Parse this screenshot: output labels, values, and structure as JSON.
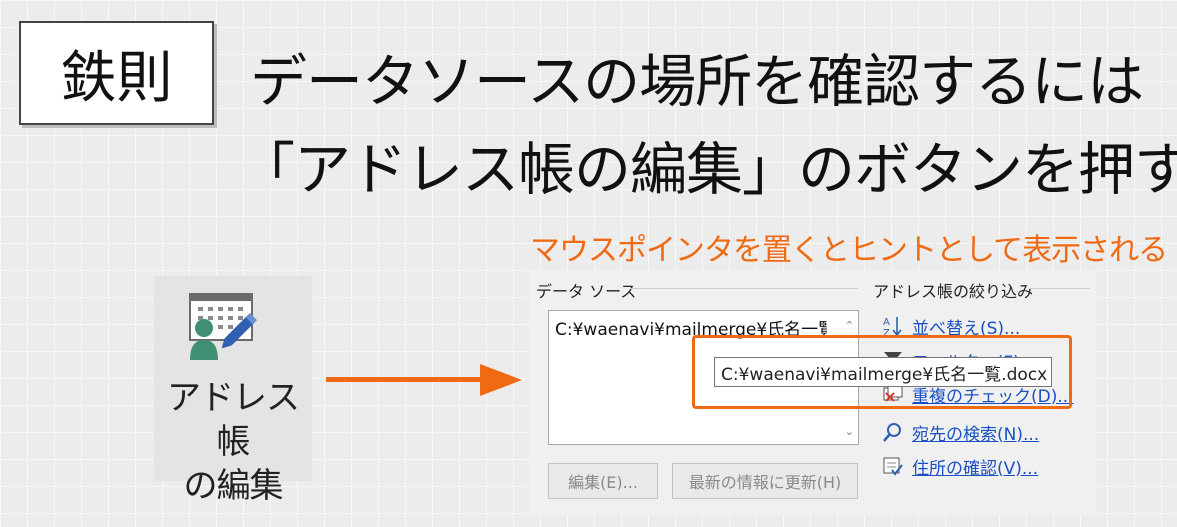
{
  "rule_label": "鉄則",
  "headline": {
    "line1": "データソースの場所を確認するには",
    "line2": "「アドレス帳の編集」のボタンを押す"
  },
  "hint_caption": "マウスポインタを置くとヒントとして表示される",
  "ribbon_button": {
    "label_line1": "アドレス帳",
    "label_line2": "の編集",
    "icon": "address-book-edit-icon"
  },
  "dialog": {
    "data_source": {
      "title": "データ ソース",
      "list_item": "C:¥waenavi¥mailmerge¥氏名一覧",
      "buttons": {
        "edit": "編集(E)...",
        "refresh": "最新の情報に更新(H)"
      }
    },
    "filter": {
      "title": "アドレス帳の絞り込み",
      "links": [
        {
          "label": "並べ替え(S)...",
          "icon": "sort-icon"
        },
        {
          "label": "フィルター(F)...",
          "icon": "filter-icon"
        },
        {
          "label": "重複のチェック(D)...",
          "icon": "duplicate-check-icon"
        },
        {
          "label": "宛先の検索(N)...",
          "icon": "search-icon"
        },
        {
          "label": "住所の確認(V)...",
          "icon": "address-validate-icon"
        }
      ]
    }
  },
  "tooltip": "C:¥waenavi¥mailmerge¥氏名一覧.docx",
  "colors": {
    "accent": "#ef6a12",
    "link": "#1a4fc4"
  }
}
